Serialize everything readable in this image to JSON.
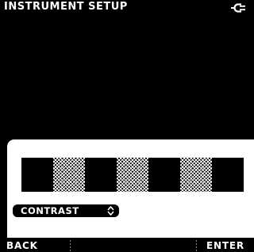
{
  "title_bar": {
    "title": "INSTRUMENT SETUP",
    "power_icon": "power-plug-icon"
  },
  "contrast": {
    "label": "CONTRAST",
    "icon": "up-down-arrows-icon"
  },
  "test_pattern": {
    "bars": [
      "black",
      "gray",
      "black",
      "gray",
      "black",
      "gray",
      "black"
    ]
  },
  "softkeys": {
    "left": "BACK",
    "right": "ENTER"
  }
}
